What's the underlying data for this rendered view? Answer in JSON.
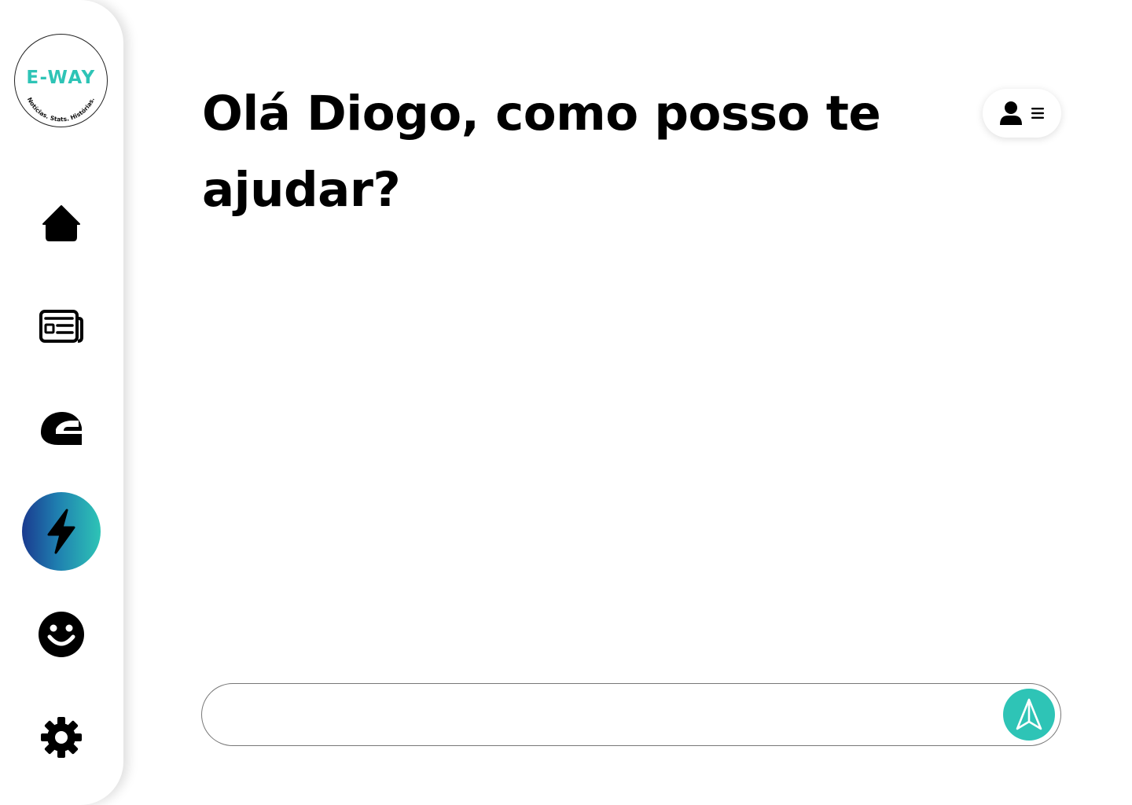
{
  "brand": {
    "name": "E-WAY",
    "tagline": "Notícias. Stats. Histórias.",
    "accent_color": "#2ec4b6"
  },
  "sidebar": {
    "items": [
      {
        "id": "home",
        "icon": "home-icon",
        "active": false
      },
      {
        "id": "news",
        "icon": "newspaper-icon",
        "active": false
      },
      {
        "id": "helmet",
        "icon": "helmet-icon",
        "active": false
      },
      {
        "id": "assistant",
        "icon": "lightning-bolt-icon",
        "active": true
      },
      {
        "id": "fun",
        "icon": "smiley-icon",
        "active": false
      },
      {
        "id": "settings",
        "icon": "gear-icon",
        "active": false
      }
    ],
    "active_gradient": [
      "#1a3a8f",
      "#2ec4b6"
    ]
  },
  "header": {
    "greeting": "Olá Diogo, como posso te ajudar?",
    "profile_menu": {
      "icons": [
        "user-icon",
        "menu-lines-icon"
      ]
    }
  },
  "chat": {
    "input_value": "",
    "input_placeholder": "",
    "send_icon": "send-arrow-icon"
  }
}
